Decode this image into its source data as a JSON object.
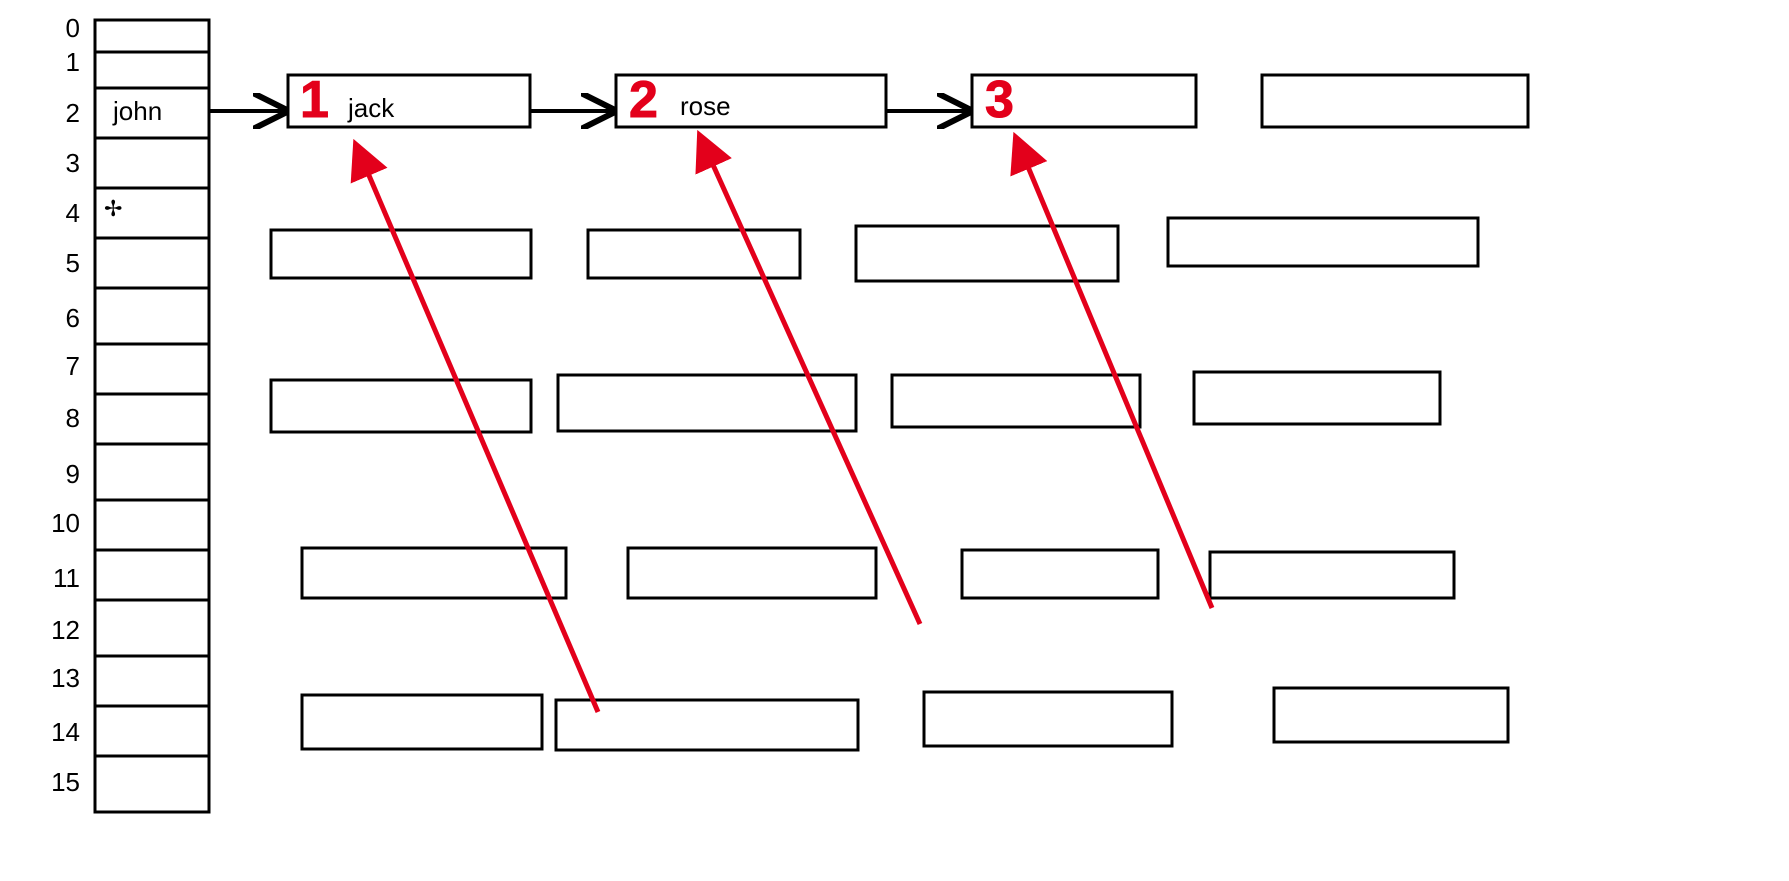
{
  "hashTable": {
    "slotCount": 16,
    "slotLabels": [
      "0",
      "1",
      "2",
      "3",
      "4",
      "5",
      "6",
      "7",
      "8",
      "9",
      "10",
      "11",
      "12",
      "13",
      "14",
      "15"
    ],
    "occupiedIndex": 2,
    "occupiedValue": "john",
    "cursorSlot": 4
  },
  "chain": {
    "nodes": [
      {
        "annotation": "1",
        "label": "jack"
      },
      {
        "annotation": "2",
        "label": "rose"
      },
      {
        "annotation": "3",
        "label": ""
      }
    ],
    "extraBoxAfterChain": true
  },
  "gridRows": 4,
  "gridCols": 4,
  "annotations": {
    "redArrows": 3
  }
}
